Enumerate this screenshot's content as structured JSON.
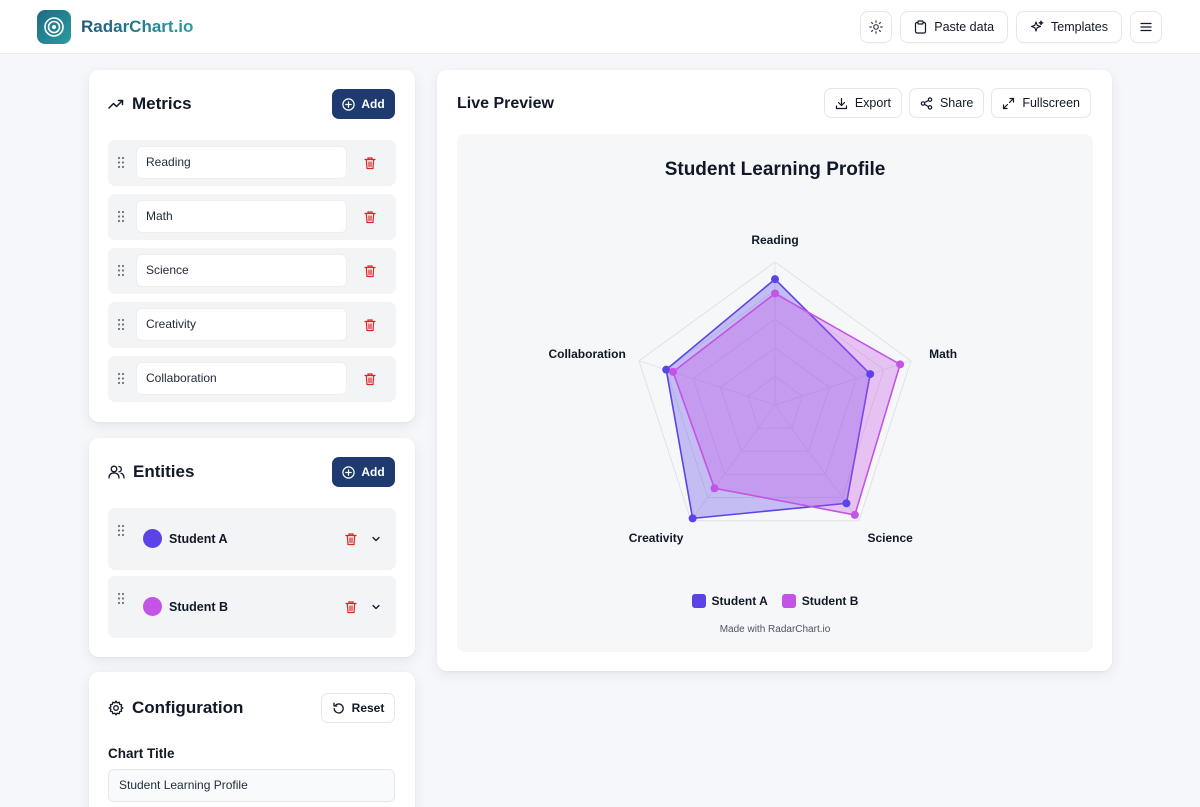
{
  "header": {
    "brand": "RadarChart.io",
    "paste_label": "Paste data",
    "templates_label": "Templates"
  },
  "metrics": {
    "title": "Metrics",
    "add_label": "Add",
    "items": [
      {
        "label": "Reading"
      },
      {
        "label": "Math"
      },
      {
        "label": "Science"
      },
      {
        "label": "Creativity"
      },
      {
        "label": "Collaboration"
      }
    ]
  },
  "entities": {
    "title": "Entities",
    "add_label": "Add",
    "items": [
      {
        "name": "Student A",
        "color": "#5b43e8"
      },
      {
        "name": "Student B",
        "color": "#c354e6"
      }
    ]
  },
  "configuration": {
    "title": "Configuration",
    "reset_label": "Reset",
    "chart_title_label": "Chart Title",
    "chart_title_value": "Student Learning Profile"
  },
  "preview": {
    "title": "Live Preview",
    "export_label": "Export",
    "share_label": "Share",
    "fullscreen_label": "Fullscreen",
    "made_with": "Made with RadarChart.io"
  },
  "colors": {
    "primary_button": "#1e3a6e",
    "delete_icon": "#dc2626",
    "student_a": "#5b43e8",
    "student_b": "#c354e6"
  },
  "chart_data": {
    "type": "radar",
    "title": "Student Learning Profile",
    "axes": [
      "Reading",
      "Math",
      "Science",
      "Creativity",
      "Collaboration"
    ],
    "max": 100,
    "rings": 5,
    "series": [
      {
        "name": "Student A",
        "color": "#5b43e8",
        "values": [
          88,
          70,
          85,
          98,
          80
        ]
      },
      {
        "name": "Student B",
        "color": "#c354e6",
        "values": [
          78,
          92,
          95,
          72,
          75
        ]
      }
    ],
    "legend": "bottom"
  }
}
